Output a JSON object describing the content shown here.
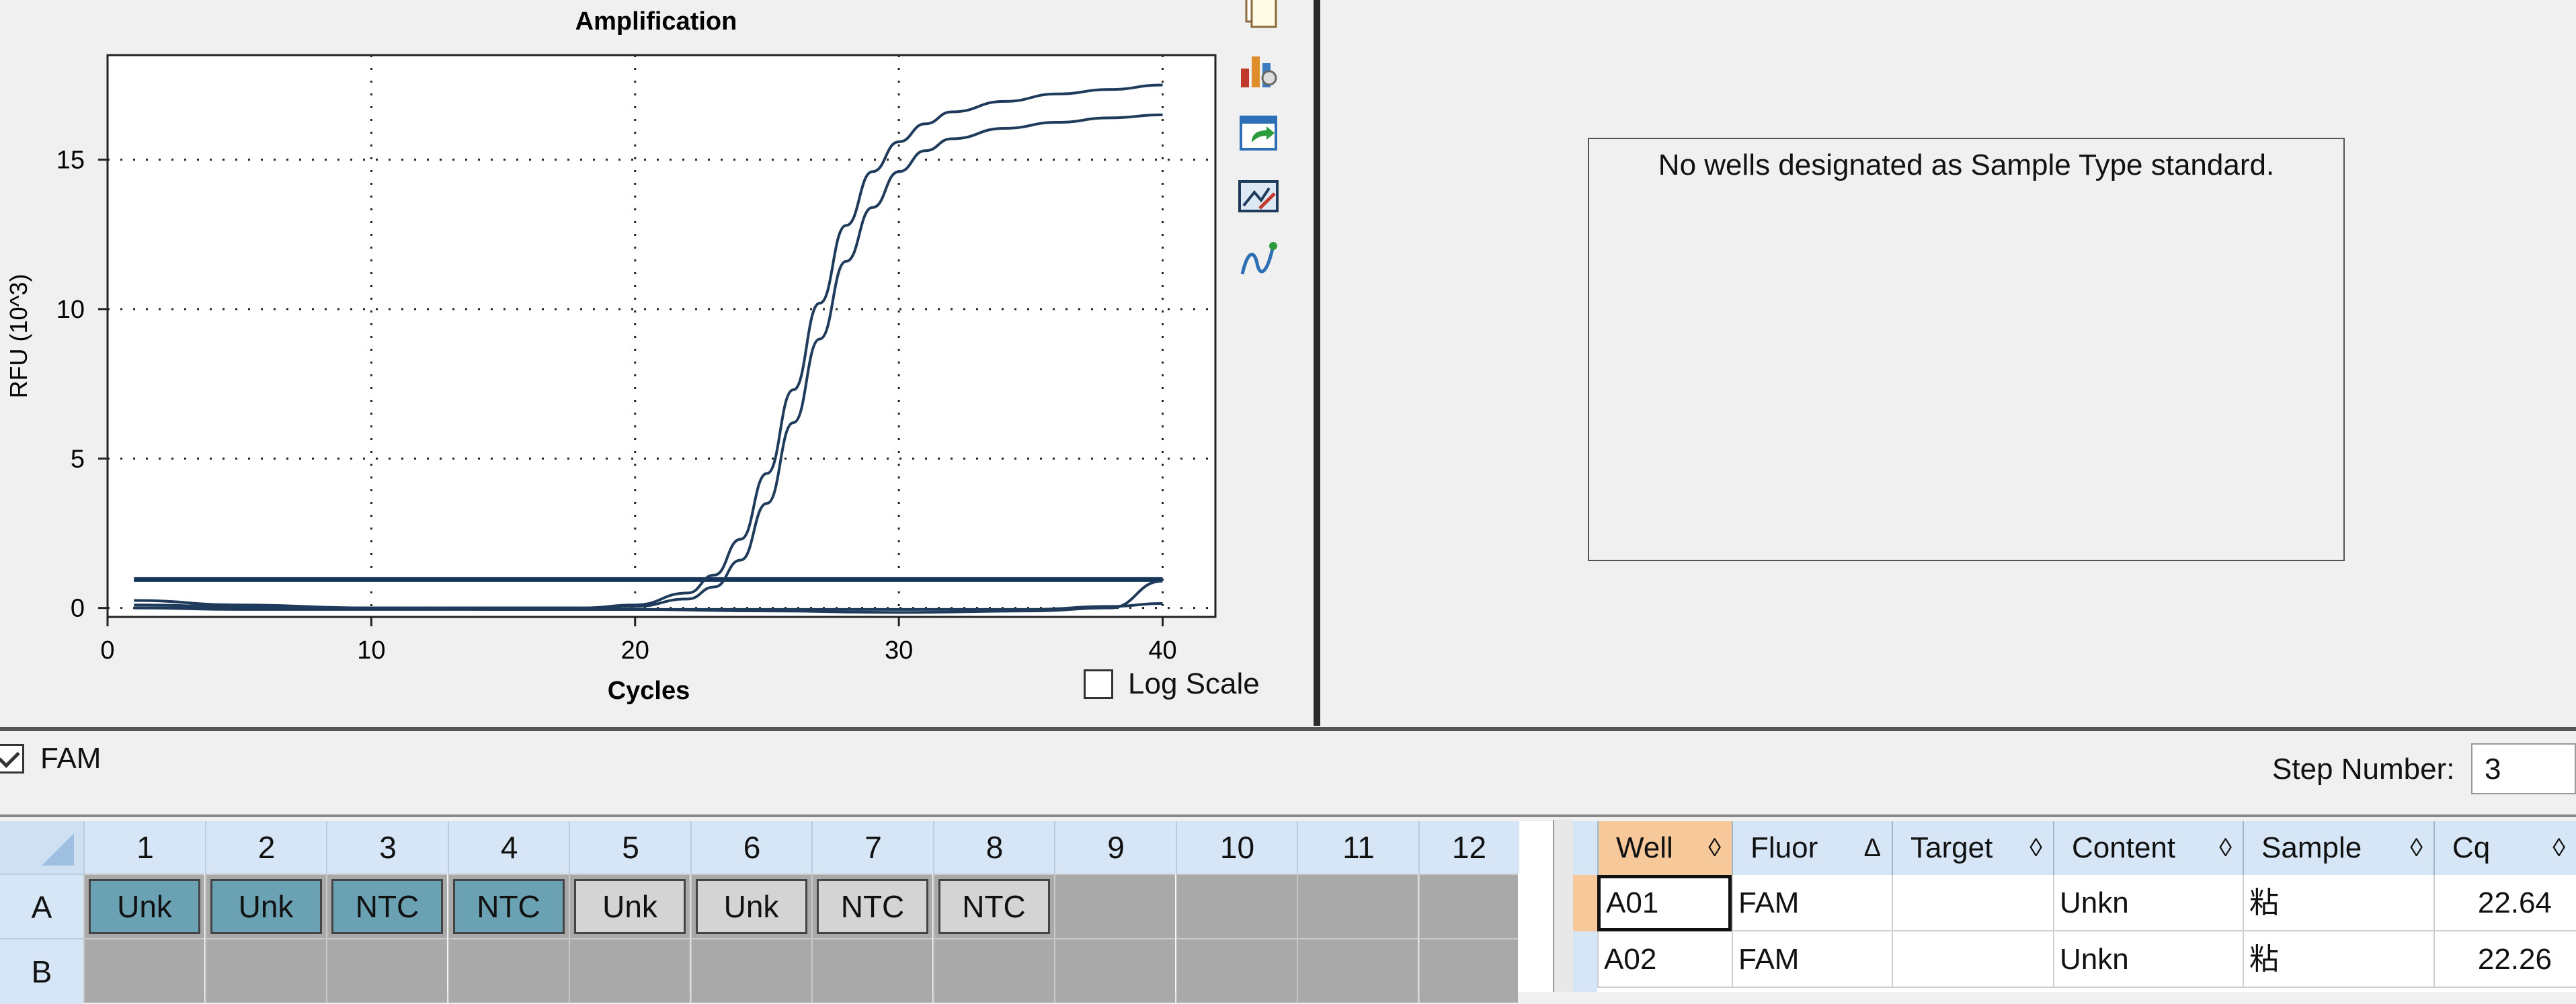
{
  "chart": {
    "title": "Amplification",
    "xlabel": "Cycles",
    "ylabel": "RFU (10^3)",
    "log_scale_label": "Log Scale",
    "log_scale_checked": false
  },
  "chart_data": {
    "type": "line",
    "title": "Amplification",
    "xlabel": "Cycles",
    "ylabel": "RFU (10^3)",
    "xlim": [
      0,
      42
    ],
    "ylim": [
      -0.3,
      18.5
    ],
    "xticks": [
      0,
      10,
      20,
      30,
      40
    ],
    "yticks": [
      0,
      5,
      10,
      15
    ],
    "grid": true,
    "threshold": 0.95,
    "series": [
      {
        "x": [
          1,
          5,
          10,
          15,
          18,
          20,
          22,
          23,
          24,
          25,
          26,
          27,
          28,
          29,
          30,
          31,
          32,
          34,
          36,
          38,
          40
        ],
        "y": [
          0.1,
          0.05,
          0,
          0,
          0,
          0.1,
          0.5,
          1.1,
          2.3,
          4.5,
          7.3,
          10.2,
          12.8,
          14.6,
          15.6,
          16.2,
          16.6,
          16.95,
          17.2,
          17.35,
          17.5
        ]
      },
      {
        "x": [
          1,
          5,
          10,
          15,
          18,
          20,
          22,
          23,
          24,
          25,
          26,
          27,
          28,
          29,
          30,
          31,
          32,
          34,
          36,
          38,
          40
        ],
        "y": [
          0.25,
          0.1,
          0,
          0,
          0,
          0.05,
          0.3,
          0.7,
          1.6,
          3.5,
          6.2,
          9.0,
          11.6,
          13.4,
          14.6,
          15.3,
          15.7,
          16.05,
          16.25,
          16.4,
          16.5
        ]
      },
      {
        "x": [
          1,
          5,
          10,
          15,
          20,
          25,
          30,
          35,
          38,
          40
        ],
        "y": [
          0,
          -0.05,
          -0.05,
          -0.05,
          -0.05,
          -0.1,
          -0.15,
          -0.1,
          0,
          0.9
        ]
      },
      {
        "x": [
          1,
          5,
          10,
          15,
          20,
          25,
          30,
          35,
          38,
          40
        ],
        "y": [
          0,
          0,
          0,
          -0.05,
          -0.05,
          -0.05,
          -0.05,
          -0.05,
          0.05,
          0.15
        ]
      }
    ]
  },
  "standard_curve": {
    "message": "No wells designated as Sample Type standard."
  },
  "fluor_bar": {
    "fam_label": "FAM",
    "fam_checked": true,
    "step_label": "Step Number:",
    "step_value": "3"
  },
  "plate": {
    "columns": [
      "1",
      "2",
      "3",
      "4",
      "5",
      "6",
      "7",
      "8",
      "9",
      "10",
      "11",
      "12"
    ],
    "rows": [
      {
        "label": "A",
        "cells": [
          {
            "text": "Unk",
            "style": "blue"
          },
          {
            "text": "Unk",
            "style": "blue"
          },
          {
            "text": "NTC",
            "style": "blue"
          },
          {
            "text": "NTC",
            "style": "blue"
          },
          {
            "text": "Unk",
            "style": "gray"
          },
          {
            "text": "Unk",
            "style": "gray"
          },
          {
            "text": "NTC",
            "style": "gray"
          },
          {
            "text": "NTC",
            "style": "gray"
          },
          {
            "text": "",
            "style": "empty"
          },
          {
            "text": "",
            "style": "empty"
          },
          {
            "text": "",
            "style": "empty"
          },
          {
            "text": "",
            "style": "empty"
          }
        ]
      },
      {
        "label": "B",
        "cells": []
      }
    ]
  },
  "results": {
    "headers": [
      {
        "label": "Well",
        "sort": "◊",
        "active": true
      },
      {
        "label": "Fluor",
        "sort": "Δ",
        "active": false
      },
      {
        "label": "Target",
        "sort": "◊",
        "active": false
      },
      {
        "label": "Content",
        "sort": "◊",
        "active": false
      },
      {
        "label": "Sample",
        "sort": "◊",
        "active": false
      },
      {
        "label": "Cq",
        "sort": "◊",
        "active": false
      }
    ],
    "rows": [
      {
        "well": "A01",
        "fluor": "FAM",
        "target": "",
        "content": "Unkn",
        "sample": "粘",
        "cq": "22.64"
      },
      {
        "well": "A02",
        "fluor": "FAM",
        "target": "",
        "content": "Unkn",
        "sample": "粘",
        "cq": "22.26"
      }
    ]
  },
  "colors": {
    "curve": "#1f3b5c",
    "threshold": "#15345a",
    "plate_blue": "#6aa2b4",
    "plate_gray": "#d4d4d4",
    "header_blue": "#d6e6f6",
    "header_active": "#f6c89a"
  },
  "icons": [
    "copy-icon",
    "chart-settings-icon",
    "export-icon",
    "chart-style-icon",
    "curve-fit-icon"
  ]
}
